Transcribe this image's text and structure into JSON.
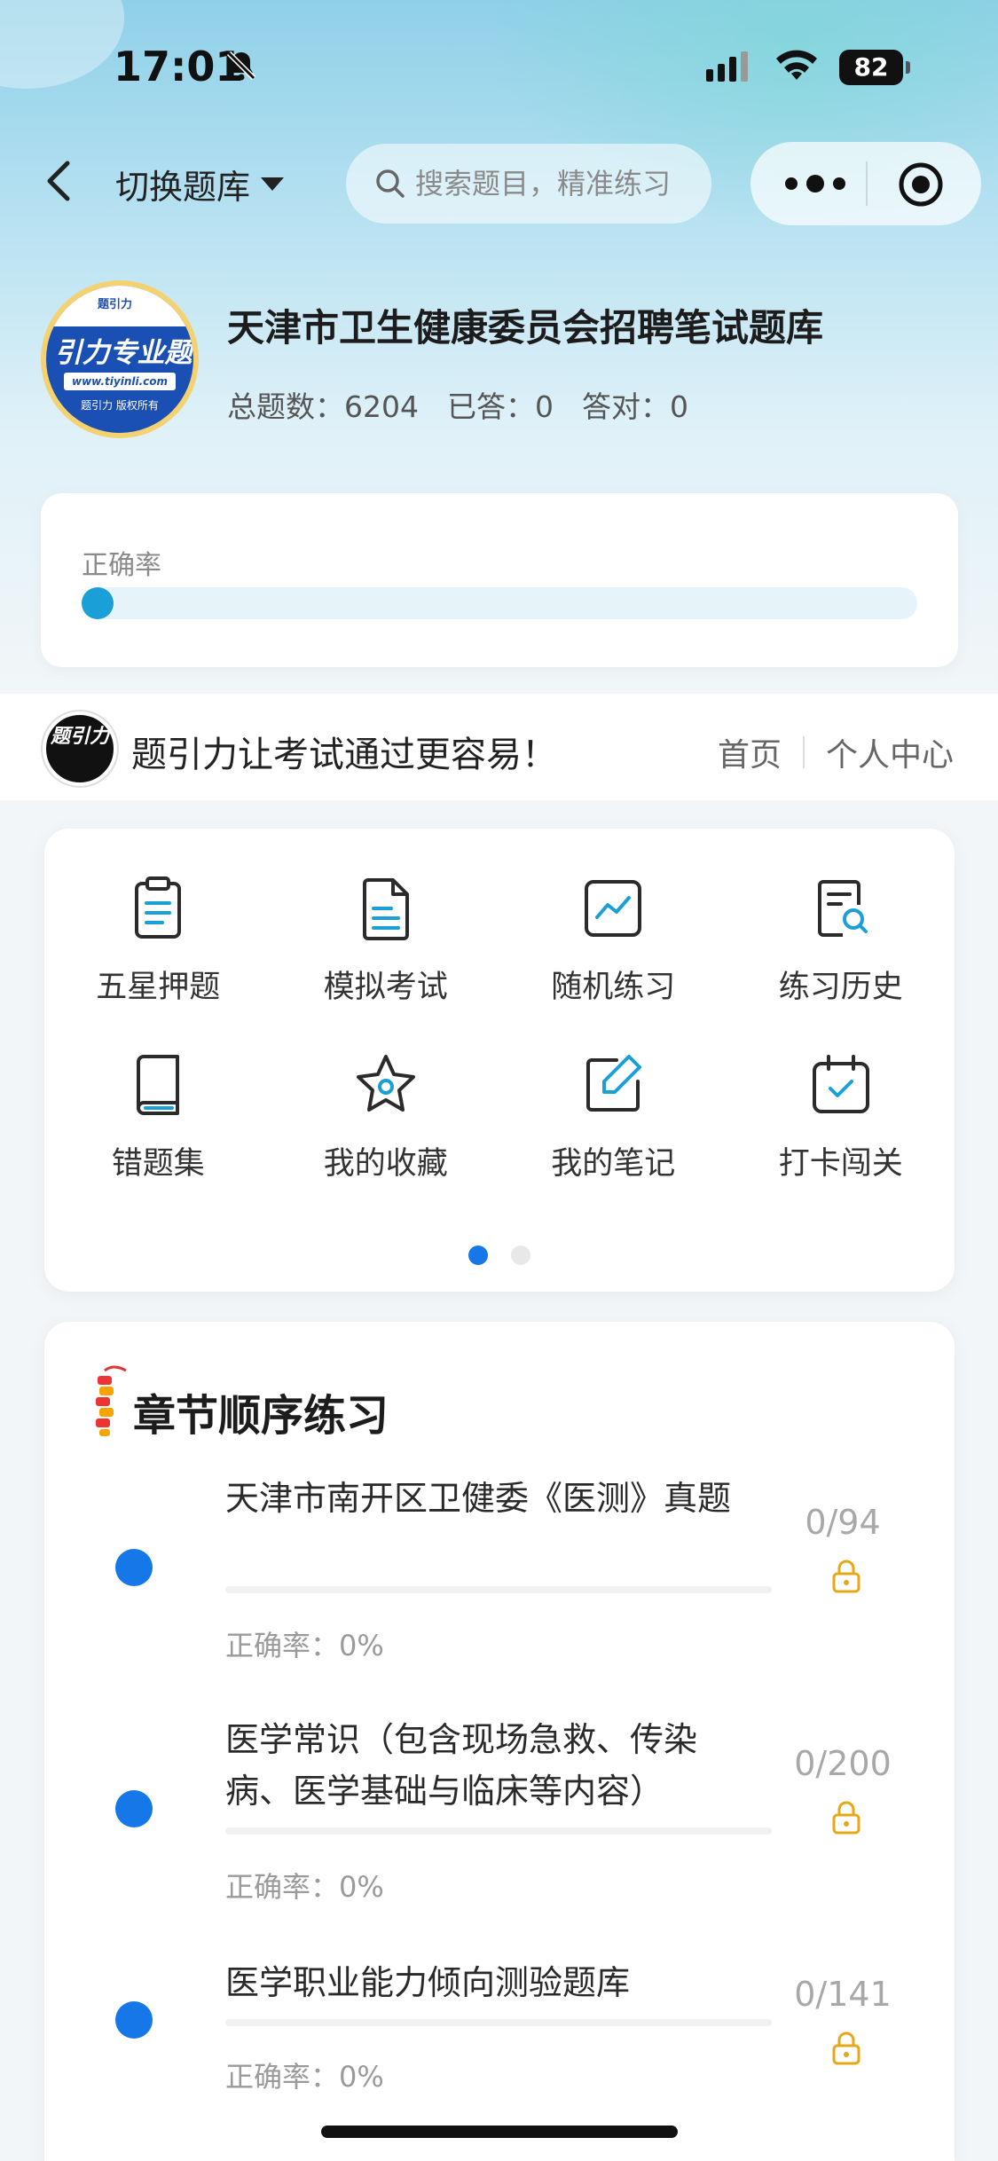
{
  "status_bar": {
    "time": "17:01",
    "battery": "82"
  },
  "nav": {
    "switch_label": "切换题库",
    "search_placeholder": "搜索题目，精准练习"
  },
  "bank": {
    "logo_text": "引力专业题",
    "logo_tag": "题引力",
    "logo_url": "www.tiyinli.com",
    "logo_copyright": "题引力 版权所有",
    "title": "天津市卫生健康委员会招聘笔试题库",
    "stats": {
      "total": "总题数：6204",
      "answered": "已答：0",
      "correct": "答对：0"
    },
    "accuracy_label": "正确率",
    "accuracy_value": 0
  },
  "slogan": {
    "logo_text": "题引力",
    "text": "题引力让考试通过更容易！",
    "nav_home": "首页",
    "nav_profile": "个人中心"
  },
  "menu": {
    "items": [
      {
        "label": "五星押题",
        "icon": "clipboard-icon"
      },
      {
        "label": "模拟考试",
        "icon": "document-icon"
      },
      {
        "label": "随机练习",
        "icon": "chart-line-icon"
      },
      {
        "label": "练习历史",
        "icon": "history-search-icon"
      },
      {
        "label": "错题集",
        "icon": "book-icon"
      },
      {
        "label": "我的收藏",
        "icon": "star-icon"
      },
      {
        "label": "我的笔记",
        "icon": "edit-icon"
      },
      {
        "label": "打卡闯关",
        "icon": "calendar-check-icon"
      }
    ],
    "page": 1,
    "pages": 2
  },
  "chapters": {
    "title": "章节顺序练习",
    "items": [
      {
        "name": "天津市南开区卫健委《医测》真题",
        "count": "0/94",
        "accuracy": "正确率：0%"
      },
      {
        "name": "医学常识（包含现场急救、传染病、医学基础与临床等内容）",
        "count": "0/200",
        "accuracy": "正确率：0%"
      },
      {
        "name": "医学职业能力倾向测验题库",
        "count": "0/141",
        "accuracy": "正确率：0%"
      }
    ]
  },
  "colors": {
    "accent": "#1677e8",
    "progress": "#1a9fd6",
    "lock": "#e6a817"
  }
}
